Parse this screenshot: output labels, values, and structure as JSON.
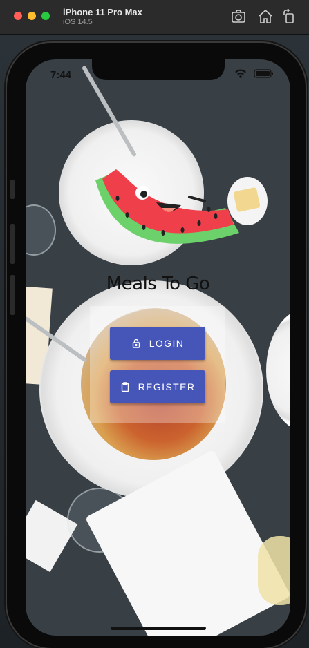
{
  "simulator": {
    "device_name": "iPhone 11 Pro Max",
    "os_version": "iOS 14.5",
    "toolbar_icons": [
      "screenshot-icon",
      "home-icon",
      "rotate-icon"
    ]
  },
  "status_bar": {
    "time": "7:44",
    "icons": [
      "wifi-icon",
      "battery-icon"
    ]
  },
  "app": {
    "title": "Meals To Go",
    "mascot": "watermelon-illustration",
    "buttons": {
      "login": {
        "label": "LOGIN",
        "icon": "lock-icon"
      },
      "register": {
        "label": "REGISTER",
        "icon": "clipboard-icon"
      }
    },
    "colors": {
      "button": "#4655b8",
      "button_text": "#ffffff",
      "watermelon_flesh": "#ee3f4a",
      "watermelon_rind": "#6cd16a"
    }
  }
}
